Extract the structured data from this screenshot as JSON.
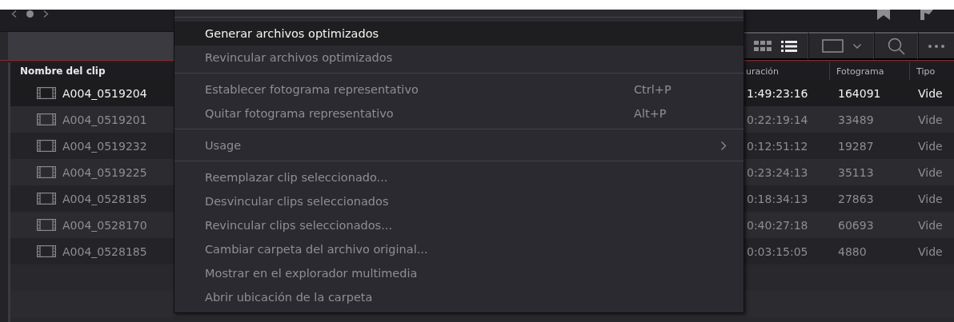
{
  "clip_table": {
    "columns": [
      {
        "label": "Nombre del clip"
      },
      {
        "label": "uración"
      },
      {
        "label": "Fotograma"
      },
      {
        "label": "Tipo"
      }
    ],
    "rows": [
      {
        "name": "A004_0519204",
        "duration": "1:49:23:16",
        "frames": "164091",
        "type": "Vide",
        "selected": true
      },
      {
        "name": "A004_0519201",
        "duration": "0:22:19:14",
        "frames": "33489",
        "type": "Vide",
        "selected": false
      },
      {
        "name": "A004_0519232",
        "duration": "0:12:51:12",
        "frames": "19287",
        "type": "Vide",
        "selected": false
      },
      {
        "name": "A004_0519225",
        "duration": "0:23:24:13",
        "frames": "35113",
        "type": "Vide",
        "selected": false
      },
      {
        "name": "A004_0528185",
        "duration": "0:18:34:13",
        "frames": "27863",
        "type": "Vide",
        "selected": false
      },
      {
        "name": "A004_0528170",
        "duration": "0:40:27:18",
        "frames": "60693",
        "type": "Vide",
        "selected": false
      },
      {
        "name": "A004_0528185",
        "duration": "0:03:15:05",
        "frames": "4880",
        "type": "Vide",
        "selected": false
      }
    ]
  },
  "context_menu": {
    "groups": [
      {
        "items": [
          {
            "label": "Generar archivos optimizados",
            "selected": true,
            "has_submenu": false
          },
          {
            "label": "Revincular archivos optimizados",
            "selected": false,
            "has_submenu": false
          }
        ]
      },
      {
        "items": [
          {
            "label": "Establecer fotograma representativo",
            "shortcut": "Ctrl+P",
            "selected": false,
            "has_submenu": false
          },
          {
            "label": "Quitar fotograma representativo",
            "shortcut": "Alt+P",
            "selected": false,
            "has_submenu": false
          }
        ]
      },
      {
        "items": [
          {
            "label": "Usage",
            "selected": false,
            "has_submenu": true
          }
        ]
      },
      {
        "items": [
          {
            "label": "Reemplazar clip seleccionado...",
            "selected": false,
            "has_submenu": false
          },
          {
            "label": "Desvincular clips seleccionados",
            "selected": false,
            "has_submenu": false
          },
          {
            "label": "Revincular clips seleccionados...",
            "selected": false,
            "has_submenu": false
          },
          {
            "label": "Cambiar carpeta del archivo original...",
            "selected": false,
            "has_submenu": false
          },
          {
            "label": "Mostrar en el explorador multimedia",
            "selected": false,
            "has_submenu": false
          },
          {
            "label": "Abrir ubicación de la carpeta",
            "selected": false,
            "has_submenu": false
          }
        ]
      }
    ]
  }
}
